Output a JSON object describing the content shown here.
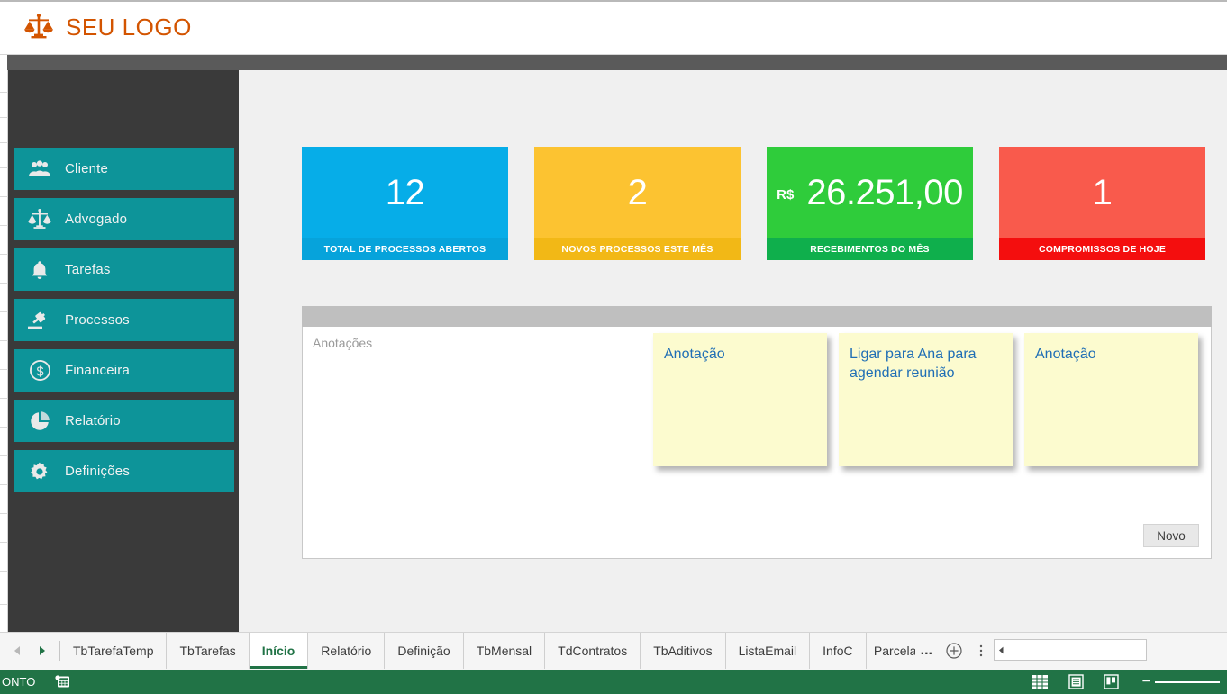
{
  "header": {
    "logo_icon": "scales-of-justice-icon",
    "logo_text": "SEU LOGO",
    "brand_color": "#D35400"
  },
  "sidebar": {
    "background_color": "#3a3a3a",
    "item_color": "#0d9499",
    "items": [
      {
        "label": "Cliente",
        "icon": "users-icon"
      },
      {
        "label": "Advogado",
        "icon": "scales-of-justice-icon"
      },
      {
        "label": "Tarefas",
        "icon": "bell-icon"
      },
      {
        "label": "Processos",
        "icon": "gavel-icon"
      },
      {
        "label": "Financeira",
        "icon": "dollar-circle-icon"
      },
      {
        "label": "Relatório",
        "icon": "pie-chart-icon"
      },
      {
        "label": "Definições",
        "icon": "gear-icon"
      }
    ]
  },
  "kpis": [
    {
      "value": "12",
      "currency": "",
      "label": "TOTAL DE PROCESSOS ABERTOS",
      "color": "#06ADE8",
      "foot_color": "#06A3DB"
    },
    {
      "value": "2",
      "currency": "",
      "label": "NOVOS PROCESSOS ESTE MÊS",
      "color": "#FCC331",
      "foot_color": "#F2B816"
    },
    {
      "value": "26.251,00",
      "currency": "R$",
      "label": "RECEBIMENTOS DO MÊS",
      "color": "#2FCC3B",
      "foot_color": "#0FAF4C"
    },
    {
      "value": "1",
      "currency": "",
      "label": "COMPROMISSOS DE HOJE",
      "color": "#F95A4C",
      "foot_color": "#F40E0E"
    }
  ],
  "notes_panel": {
    "title": "Anotações",
    "new_button": "Novo",
    "notes": [
      {
        "text": "Anotação"
      },
      {
        "text": "Ligar para Ana para agendar reunião"
      },
      {
        "text": "Anotação"
      }
    ]
  },
  "sheet_tabs": {
    "nav_prev_icon": "triangle-left-icon",
    "nav_next_icon": "triangle-right-icon",
    "add_icon": "plus-circle-icon",
    "kebab_icon": "more-vertical-icon",
    "overflow_ellipsis": "...",
    "tabs": [
      {
        "label": "TbTarefaTemp",
        "active": false
      },
      {
        "label": "TbTarefas",
        "active": false
      },
      {
        "label": "Início",
        "active": true
      },
      {
        "label": "Relatório",
        "active": false
      },
      {
        "label": "Definição",
        "active": false
      },
      {
        "label": "TbMensal",
        "active": false
      },
      {
        "label": "TdContratos",
        "active": false
      },
      {
        "label": "TbAditivos",
        "active": false
      },
      {
        "label": "ListaEmail",
        "active": false
      },
      {
        "label": "InfoC",
        "active": false
      },
      {
        "label": "Parcela",
        "active": false
      }
    ],
    "active_tab_color": "#217346"
  },
  "status_bar": {
    "text": "ONTO",
    "macro_icon": "record-macro-icon",
    "background_color": "#217346",
    "views": [
      {
        "icon": "normal-view-icon"
      },
      {
        "icon": "page-layout-view-icon"
      },
      {
        "icon": "page-break-view-icon"
      }
    ],
    "zoom_minus": "−"
  }
}
